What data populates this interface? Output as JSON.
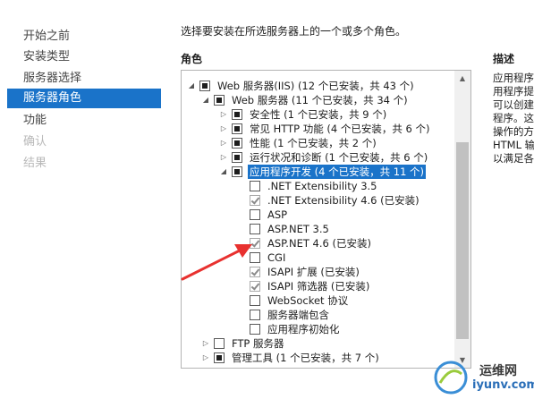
{
  "nav": {
    "items": [
      {
        "label": "开始之前",
        "state": "normal"
      },
      {
        "label": "安装类型",
        "state": "normal"
      },
      {
        "label": "服务器选择",
        "state": "normal"
      },
      {
        "label": "服务器角色",
        "state": "selected"
      },
      {
        "label": "功能",
        "state": "normal"
      },
      {
        "label": "确认",
        "state": "disabled"
      },
      {
        "label": "结果",
        "state": "disabled"
      }
    ]
  },
  "header": {
    "instruction": "选择要安装在所选服务器上的一个或多个角色。",
    "roles_title": "角色",
    "desc_title": "描述"
  },
  "tree": {
    "rows": [
      {
        "label": "Web 服务器(IIS) (12 个已安装，共 43 个)",
        "expander": "expanded",
        "check": "partial"
      },
      {
        "label": "Web 服务器 (11 个已安装，共 34 个)",
        "expander": "expanded",
        "check": "partial"
      },
      {
        "label": "安全性 (1 个已安装，共 9 个)",
        "expander": "collapsed",
        "check": "partial"
      },
      {
        "label": "常见 HTTP 功能 (4 个已安装，共 6 个)",
        "expander": "collapsed",
        "check": "partial"
      },
      {
        "label": "性能 (1 个已安装，共 2 个)",
        "expander": "collapsed",
        "check": "partial"
      },
      {
        "label": "运行状况和诊断 (1 个已安装，共 6 个)",
        "expander": "collapsed",
        "check": "partial"
      },
      {
        "label": "应用程序开发 (4 个已安装，共 11 个)",
        "expander": "expanded",
        "check": "partial",
        "selected": true
      },
      {
        "label": ".NET Extensibility 3.5",
        "expander": "none",
        "check": "unchecked"
      },
      {
        "label": ".NET Extensibility 4.6 (已安装)",
        "expander": "none",
        "check": "checked"
      },
      {
        "label": "ASP",
        "expander": "none",
        "check": "unchecked"
      },
      {
        "label": "ASP.NET 3.5",
        "expander": "none",
        "check": "unchecked"
      },
      {
        "label": "ASP.NET 4.6 (已安装)",
        "expander": "none",
        "check": "checked"
      },
      {
        "label": "CGI",
        "expander": "none",
        "check": "unchecked"
      },
      {
        "label": "ISAPI 扩展 (已安装)",
        "expander": "none",
        "check": "checked"
      },
      {
        "label": "ISAPI 筛选器 (已安装)",
        "expander": "none",
        "check": "checked"
      },
      {
        "label": "WebSocket 协议",
        "expander": "none",
        "check": "unchecked"
      },
      {
        "label": "服务器端包含",
        "expander": "none",
        "check": "unchecked"
      },
      {
        "label": "应用程序初始化",
        "expander": "none",
        "check": "unchecked"
      },
      {
        "label": "FTP 服务器",
        "expander": "collapsed",
        "check": "unchecked"
      },
      {
        "label": "管理工具 (1 个已安装，共 7 个)",
        "expander": "collapsed",
        "check": "partial"
      }
    ]
  },
  "description": {
    "lines": [
      "应用程序",
      "用程序提",
      "可以创建",
      "程序。这些",
      "操作的方",
      "HTML 输",
      "以满足各"
    ]
  },
  "watermark": {
    "name_cn": "运维网",
    "domain": "iyunv.com"
  },
  "colors": {
    "accent": "#1a73c9",
    "arrow": "#e8312f"
  }
}
